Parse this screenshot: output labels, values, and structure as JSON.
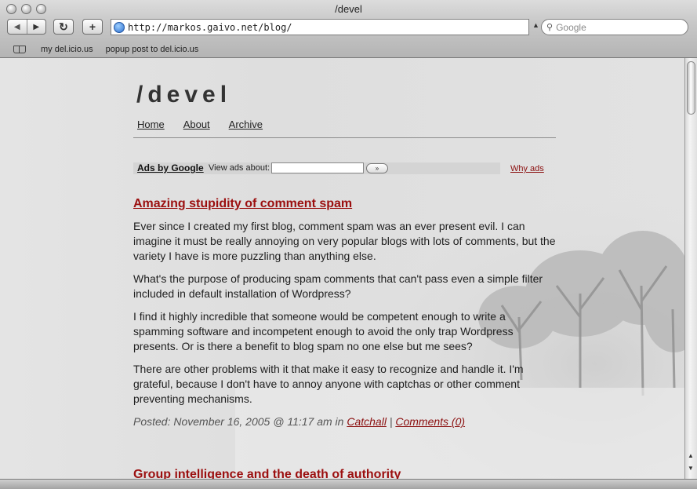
{
  "window": {
    "title": "/devel"
  },
  "toolbar": {
    "back_glyph": "◀",
    "forward_glyph": "▶",
    "reload_glyph": "↻",
    "add_glyph": "+",
    "address": "http://markos.gaivo.net/blog/",
    "search_placeholder": "Google"
  },
  "bookmarks_bar": {
    "items": [
      "my del.icio.us",
      "popup post to del.icio.us"
    ]
  },
  "site": {
    "title": "/devel",
    "nav": [
      "Home",
      "About",
      "Archive"
    ]
  },
  "ads": {
    "ads_by": "Ads by Google",
    "view_label": "View ads about:",
    "go_label": "»",
    "why_label": "Why ads"
  },
  "post": {
    "title": "Amazing stupidity of comment spam",
    "paragraphs": [
      "Ever since I created my first blog, comment spam was an ever present evil. I can imagine it must be really annoying on very popular blogs with lots of comments, but the variety I have is more puzzling than anything else.",
      "What's the purpose of producing spam comments that can't pass even a simple filter included in default installation of Wordpress?",
      "I find it highly incredible that someone would be competent enough to write a spamming software and incompetent enough to avoid the only trap Wordpress presents. Or is there a benefit to blog spam no one else but me sees?",
      "There are other problems with it that make it easy to recognize and handle it. I'm grateful, because I don't have to annoy anyone with captchas or other comment preventing mechanisms."
    ],
    "meta_prefix": "Posted: November 16, 2005 @ 11:17 am in",
    "category": "Catchall",
    "separator": "|",
    "comments": "Comments (0)"
  },
  "next_post": {
    "title": "Group intelligence and the death of authority"
  },
  "colors": {
    "link_red": "#9b0f0f",
    "text": "#1e1e1e",
    "page_bg": "#e2e2e2"
  }
}
